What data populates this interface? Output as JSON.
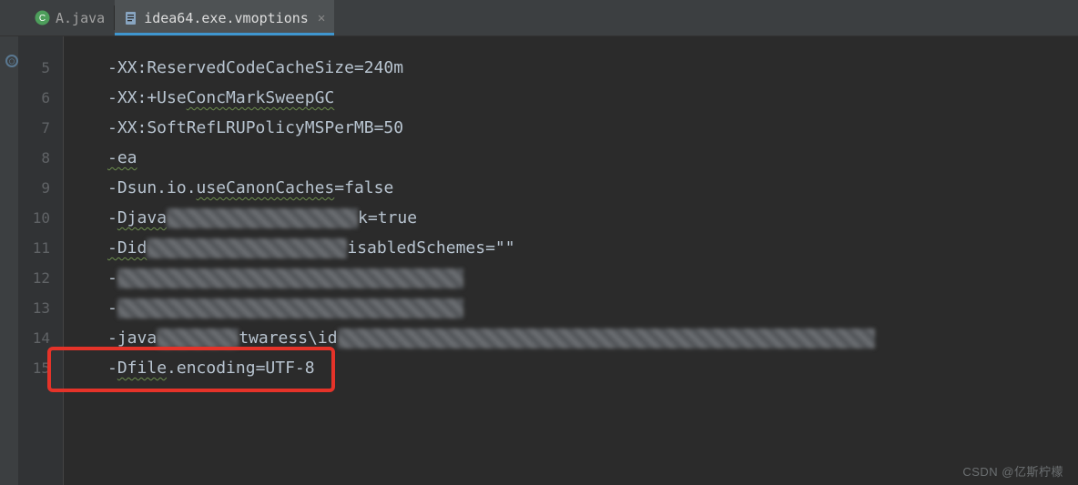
{
  "tabs": {
    "inactive": {
      "label": "A.java"
    },
    "active": {
      "label": "idea64.exe.vmoptions"
    }
  },
  "gutter": {
    "start": 5,
    "end": 15
  },
  "code": {
    "l5": "-XX:ReservedCodeCacheSize=240m",
    "l6": "-XX:+UseConcMarkSweepGC",
    "l7": "-XX:SoftRefLRUPolicyMSPerMB=50",
    "l8": "-ea",
    "l9": "-Dsun.io.useCanonCaches=false",
    "l10a": "-Djava",
    "l10b": "k=true",
    "l11a": "-Did",
    "l11b": "isabledSchemes=\"\"",
    "l12a": "-",
    "l13a": "-",
    "l14a": "-java",
    "l14b": "twaress\\id",
    "l15": "-Dfile.encoding=UTF-8"
  },
  "watermark": "CSDN @亿斯柠檬"
}
